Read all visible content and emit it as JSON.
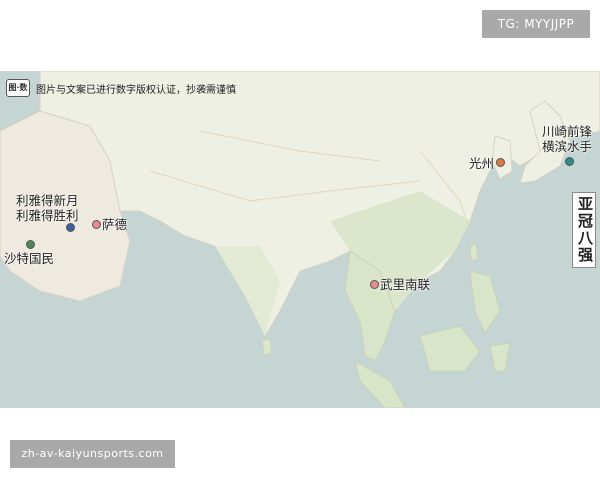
{
  "top_tag": "TG: MYYJJPP",
  "bottom_tag": "zh-av-kaiyunsports.com",
  "map": {
    "logo_text": "图·数",
    "copyright": "图片与文案已进行数字版权认证，抄袭需谨慎",
    "title": "亚冠八强",
    "places": [
      {
        "id": "alnassr",
        "label": "利雅得新月\n利雅得胜利",
        "color": "#3b5fa8"
      },
      {
        "id": "sadd",
        "label": "萨德",
        "color": "#e98a8a"
      },
      {
        "id": "saudi",
        "label": "沙特国民",
        "color": "#4e8a4e"
      },
      {
        "id": "gwangju",
        "label": "光州",
        "color": "#e07a3e"
      },
      {
        "id": "kawasaki",
        "label": "川崎前锋\n横滨水手",
        "color": "#2a8c8c"
      },
      {
        "id": "buriram",
        "label": "武里南联",
        "color": "#e98a8a"
      }
    ]
  }
}
